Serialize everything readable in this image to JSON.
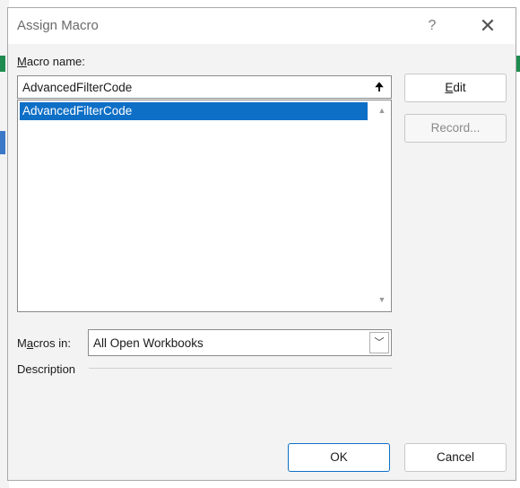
{
  "dialog": {
    "title": "Assign Macro",
    "help_glyph": "?",
    "close_glyph": "✕"
  },
  "macro_name": {
    "label_access": "M",
    "label_rest": "acro name:",
    "value": "AdvancedFilterCode",
    "collapse_glyph": "🠉"
  },
  "macro_list": {
    "items": [
      "AdvancedFilterCode"
    ],
    "scroll_up_glyph": "▲",
    "scroll_down_glyph": "▼"
  },
  "buttons": {
    "edit_access": "E",
    "edit_rest": "dit",
    "record": "Record...",
    "ok": "OK",
    "cancel": "Cancel"
  },
  "macros_in": {
    "label_pre": "M",
    "label_access": "a",
    "label_rest": "cros in:",
    "value": "All Open Workbooks",
    "arrow_glyph": "﹀"
  },
  "description": {
    "label": "Description"
  }
}
